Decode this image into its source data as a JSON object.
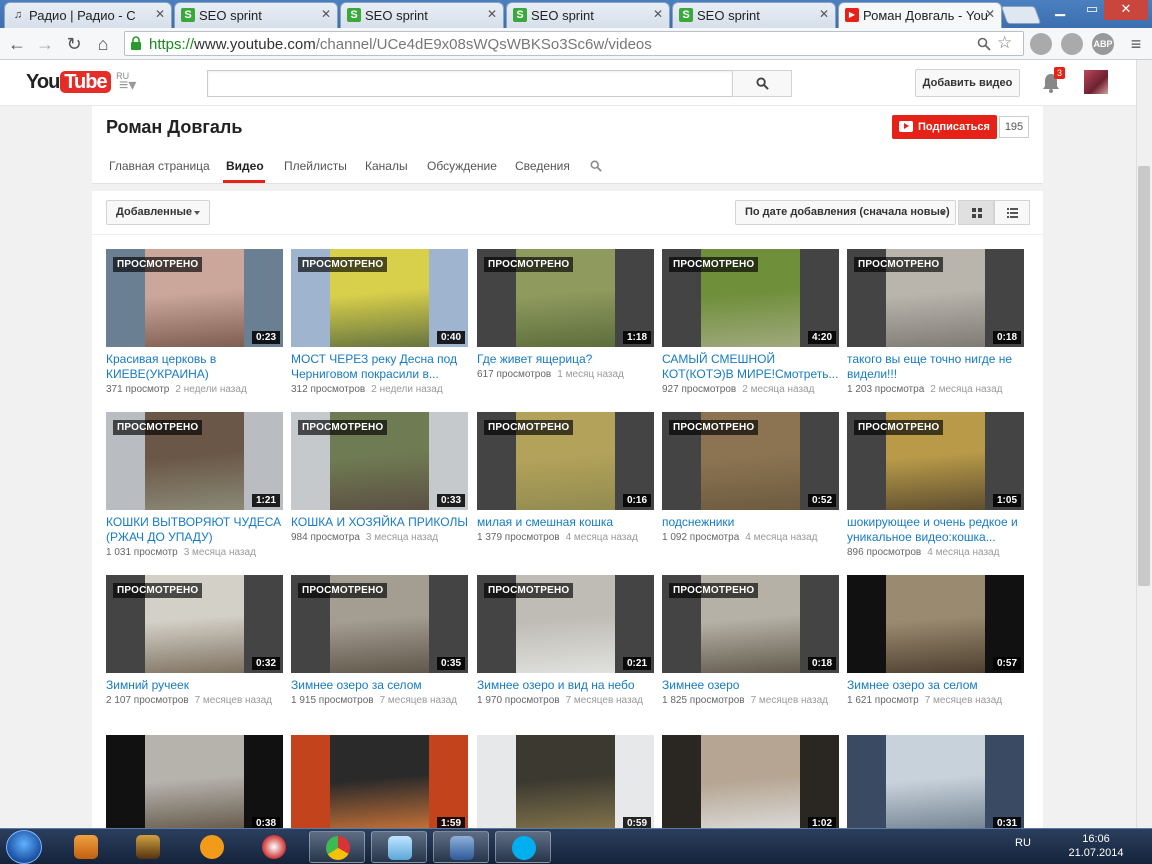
{
  "browser": {
    "tabs": [
      {
        "title": "Радио | Радио - С",
        "icon": "music-note-icon"
      },
      {
        "title": "SEO sprint",
        "icon": "seo-sprint-icon"
      },
      {
        "title": "SEO sprint",
        "icon": "seo-sprint-icon"
      },
      {
        "title": "SEO sprint",
        "icon": "seo-sprint-icon"
      },
      {
        "title": "SEO sprint",
        "icon": "seo-sprint-icon"
      },
      {
        "title": "Роман Довгаль - You",
        "icon": "youtube-icon"
      }
    ],
    "url_scheme": "https://",
    "url_host": "www.youtube.com",
    "url_path": "/channel/UCe4dE9x08sWQsWBKSo3Sc6w/videos",
    "ext_label": "ABP"
  },
  "yt": {
    "logo_you": "You",
    "logo_tube": "Tube",
    "logo_region": "RU",
    "upload_label": "Добавить видео",
    "notif_count": "3"
  },
  "channel": {
    "name": "Роман Довгаль",
    "subscribe_label": "Подписаться",
    "subscriber_count": "195",
    "tabs": [
      "Главная страница",
      "Видео",
      "Плейлисты",
      "Каналы",
      "Обсуждение",
      "Сведения"
    ],
    "active_tab": "Видео"
  },
  "sort": {
    "filter_label": "Добавленные",
    "order_label": "По дате добавления (сначала новые)"
  },
  "watched_label": "ПРОСМОТРЕНО",
  "videos": [
    {
      "title": "Красивая церковь в КИЕВЕ(УКРАИНА)",
      "views": "371 просмотр",
      "ago": "2 недели назад",
      "duration": "0:23",
      "watched": true,
      "colors": [
        "#6b7f93",
        "#caa79a",
        "#7a5a4d"
      ]
    },
    {
      "title": "МОСТ ЧЕРЕЗ реку Десна под Черниговом покрасили в...",
      "views": "312 просмотров",
      "ago": "2 недели назад",
      "duration": "0:40",
      "watched": true,
      "colors": [
        "#9fb5cf",
        "#d8cf4a",
        "#5f6f3f"
      ]
    },
    {
      "title": "Где живет ящерица?",
      "views": "617 просмотров",
      "ago": "1 месяц назад",
      "duration": "1:18",
      "watched": true,
      "colors": [
        "#444444",
        "#8f9a5e",
        "#5a6b3a"
      ]
    },
    {
      "title": "САМЫЙ СМЕШНОЙ КОТ(КОТЭ)В МИРЕ!Смотреть...",
      "views": "927 просмотров",
      "ago": "2 месяца назад",
      "duration": "4:20",
      "watched": true,
      "colors": [
        "#444444",
        "#6f8f3a",
        "#a3aa82"
      ]
    },
    {
      "title": "такого вы еще точно нигде не видели!!!",
      "views": "1 203 просмотра",
      "ago": "2 месяца назад",
      "duration": "0:18",
      "watched": true,
      "colors": [
        "#444444",
        "#b9b5ad",
        "#7c7770"
      ]
    },
    {
      "title": "КОШКИ ВЫТВОРЯЮТ ЧУДЕСА (РЖАЧ ДО УПАДУ)",
      "views": "1 031 просмотр",
      "ago": "3 месяца назад",
      "duration": "1:21",
      "watched": true,
      "colors": [
        "#b9bcc0",
        "#6a5747",
        "#8d8c78"
      ]
    },
    {
      "title": "КОШКА И ХОЗЯЙКА ПРИКОЛЫ",
      "views": "984 просмотра",
      "ago": "3 месяца назад",
      "duration": "0:33",
      "watched": true,
      "colors": [
        "#c6c9cc",
        "#6f7b52",
        "#5b4e43"
      ]
    },
    {
      "title": "милая и смешная кошка",
      "views": "1 379 просмотров",
      "ago": "4 месяца назад",
      "duration": "0:16",
      "watched": true,
      "colors": [
        "#444444",
        "#b3a25a",
        "#8f8a4f"
      ]
    },
    {
      "title": "подснежники",
      "views": "1 092 просмотра",
      "ago": "4 месяца назад",
      "duration": "0:52",
      "watched": true,
      "colors": [
        "#444444",
        "#8c7452",
        "#6b5a3e"
      ]
    },
    {
      "title": "шокирующее и очень редкое и уникальное видео:кошка...",
      "views": "896 просмотров",
      "ago": "4 месяца назад",
      "duration": "1:05",
      "watched": true,
      "colors": [
        "#444444",
        "#b89a48",
        "#5a4a2f"
      ]
    },
    {
      "title": "Зимний ручеек",
      "views": "2 107 просмотров",
      "ago": "7 месяцев назад",
      "duration": "0:32",
      "watched": true,
      "colors": [
        "#444444",
        "#d3d0c7",
        "#7a6c5c"
      ]
    },
    {
      "title": "Зимнее озеро за селом",
      "views": "1 915 просмотров",
      "ago": "7 месяцев назад",
      "duration": "0:35",
      "watched": true,
      "colors": [
        "#444444",
        "#a49d92",
        "#5d5347"
      ]
    },
    {
      "title": "Зимнее озеро и вид на небо",
      "views": "1 970 просмотров",
      "ago": "7 месяцев назад",
      "duration": "0:21",
      "watched": true,
      "colors": [
        "#444444",
        "#bfbcb5",
        "#e2e3e0"
      ]
    },
    {
      "title": "Зимнее озеро",
      "views": "1 825 просмотров",
      "ago": "7 месяцев назад",
      "duration": "0:18",
      "watched": true,
      "colors": [
        "#444444",
        "#b5b1a6",
        "#5e5648"
      ]
    },
    {
      "title": "Зимнее озеро за селом",
      "views": "1 621 просмотр",
      "ago": "7 месяцев назад",
      "duration": "0:57",
      "watched": false,
      "colors": [
        "#111111",
        "#9a8a70",
        "#4a3c2c"
      ]
    },
    {
      "title": "",
      "views": "",
      "ago": "",
      "duration": "0:38",
      "watched": false,
      "colors": [
        "#111111",
        "#b6b3ad",
        "#5c5040"
      ]
    },
    {
      "title": "",
      "views": "",
      "ago": "",
      "duration": "1:59",
      "watched": false,
      "colors": [
        "#c2431c",
        "#2a2a2a",
        "#d87a3a"
      ]
    },
    {
      "title": "",
      "views": "",
      "ago": "",
      "duration": "0:59",
      "watched": false,
      "colors": [
        "#e6e8ea",
        "#3c3a30",
        "#8a7a4f"
      ]
    },
    {
      "title": "",
      "views": "",
      "ago": "",
      "duration": "1:02",
      "watched": false,
      "colors": [
        "#2a2622",
        "#b5a592",
        "#e0e0e0"
      ]
    },
    {
      "title": "",
      "views": "",
      "ago": "",
      "duration": "0:31",
      "watched": false,
      "colors": [
        "#3a4a63",
        "#c8d2db",
        "#6b7a8a"
      ]
    }
  ],
  "taskbar": {
    "lang": "RU",
    "time": "16:06",
    "date": "21.07.2014"
  }
}
